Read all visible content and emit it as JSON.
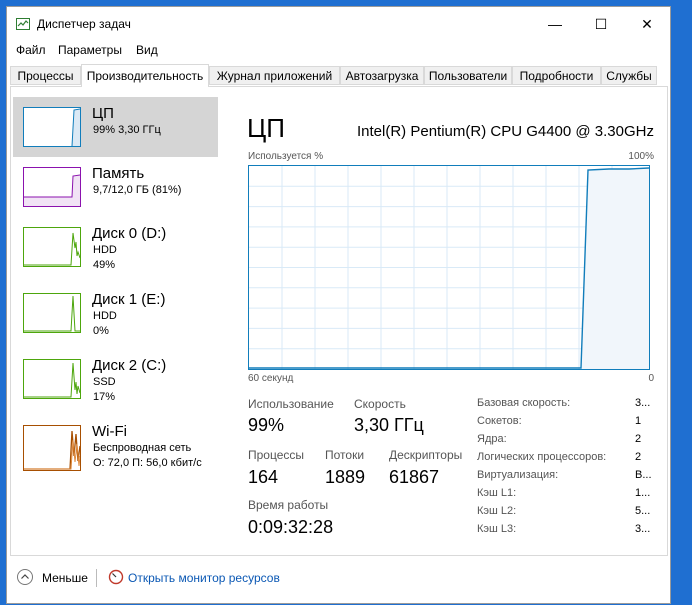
{
  "window": {
    "title": "Диспетчер задач"
  },
  "titlebar_buttons": {
    "minimize": "—",
    "maximize": "☐",
    "close": "✕"
  },
  "menu": [
    "Файл",
    "Параметры",
    "Вид"
  ],
  "tabs": [
    "Процессы",
    "Производительность",
    "Журнал приложений",
    "Автозагрузка",
    "Пользователи",
    "Подробности",
    "Службы"
  ],
  "active_tab": "Производительность",
  "sidebar": [
    {
      "name": "ЦП",
      "line2": "99% 3,30 ГГц",
      "line3": "",
      "color": "#117dbb"
    },
    {
      "name": "Память",
      "line2": "9,7/12,0 ГБ (81%)",
      "line3": "",
      "color": "#8b12ae"
    },
    {
      "name": "Диск 0 (D:)",
      "line2": "HDD",
      "line3": "49%",
      "color": "#4da60c"
    },
    {
      "name": "Диск 1 (E:)",
      "line2": "HDD",
      "line3": "0%",
      "color": "#4da60c"
    },
    {
      "name": "Диск 2 (C:)",
      "line2": "SSD",
      "line3": "17%",
      "color": "#4da60c"
    },
    {
      "name": "Wi-Fi",
      "line2": "Беспроводная сеть",
      "line3": "О: 72,0 П: 56,0 кбит/с",
      "color": "#a74f01"
    }
  ],
  "main": {
    "title": "ЦП",
    "cpu_model": "Intel(R) Pentium(R) CPU G4400 @ 3.30GHz",
    "graph_label": "Используется %",
    "graph_max": "100%",
    "axis_left": "60 секунд",
    "axis_right": "0",
    "stats": {
      "usage_label": "Использование",
      "usage_value": "99%",
      "speed_label": "Скорость",
      "speed_value": "3,30 ГГц",
      "processes_label": "Процессы",
      "processes_value": "164",
      "threads_label": "Потоки",
      "threads_value": "1889",
      "handles_label": "Дескрипторы",
      "handles_value": "61867",
      "uptime_label": "Время работы",
      "uptime_value": "0:09:32:28"
    },
    "specs": [
      {
        "label": "Базовая скорость:",
        "value": "3..."
      },
      {
        "label": "Сокетов:",
        "value": "1"
      },
      {
        "label": "Ядра:",
        "value": "2"
      },
      {
        "label": "Логических процессоров:",
        "value": "2"
      },
      {
        "label": "Виртуализация:",
        "value": "В..."
      },
      {
        "label": "Кэш L1:",
        "value": "1..."
      },
      {
        "label": "Кэш L2:",
        "value": "5..."
      },
      {
        "label": "Кэш L3:",
        "value": "3..."
      }
    ]
  },
  "footer": {
    "less": "Меньше",
    "monitor": "Открыть монитор ресурсов"
  }
}
